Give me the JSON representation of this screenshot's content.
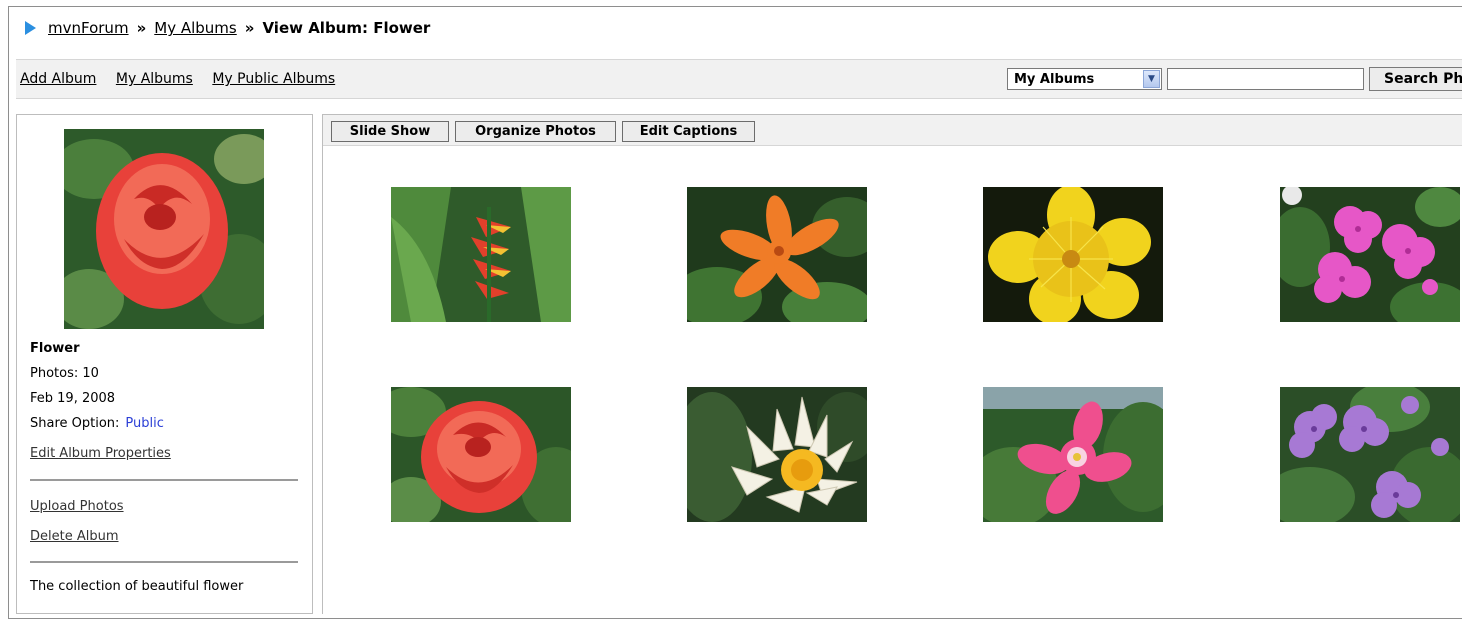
{
  "breadcrumb": {
    "root": "mvnForum",
    "sep1": "»",
    "albums": "My Albums",
    "sep2": "»",
    "current": "View Album: Flower"
  },
  "toolbar": {
    "add_album": "Add Album",
    "my_albums": "My Albums",
    "my_public_albums": "My Public Albums",
    "scope_select": "My Albums",
    "search_value": "",
    "search_button": "Search Photos"
  },
  "sidebar": {
    "album_name": "Flower",
    "photos": "Photos: 10",
    "date": "Feb 19, 2008",
    "share_label": "Share Option:",
    "share_value": "Public",
    "edit_properties": "Edit Album Properties",
    "upload_photos": "Upload Photos",
    "delete_album": "Delete Album",
    "description": "The collection of beautiful flower"
  },
  "main_toolbar": {
    "slide_show": "Slide Show",
    "organize_photos": "Organize Photos",
    "edit_captions": "Edit Captions"
  },
  "photos": [
    {
      "subject": "heliconia"
    },
    {
      "subject": "orange lily"
    },
    {
      "subject": "yellow hypericum"
    },
    {
      "subject": "pink geranium"
    },
    {
      "subject": "red rose"
    },
    {
      "subject": "white water lily"
    },
    {
      "subject": "pink desert rose"
    },
    {
      "subject": "purple mallow"
    }
  ],
  "colors": {
    "breadcrumb_arrow": "#2b8fe0",
    "public_link": "#2b3fd6",
    "toolbar_bg": "#f1f1f1"
  }
}
